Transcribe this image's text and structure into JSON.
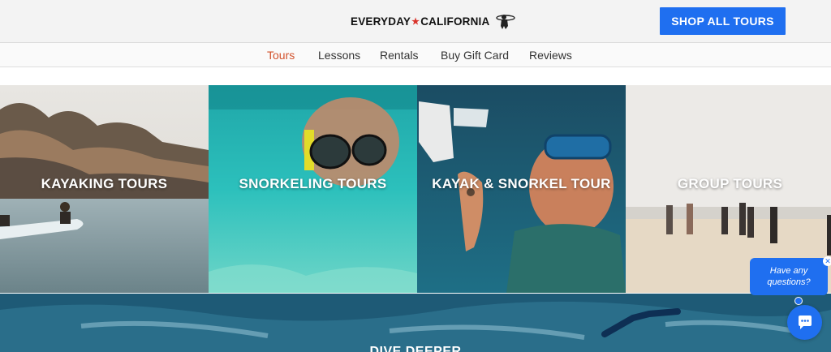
{
  "header": {
    "logo_text_left": "EVERYDAY",
    "logo_text_right": "CALIFORNIA",
    "shop_button_label": "SHOP ALL TOURS"
  },
  "nav": {
    "items": [
      {
        "label": "Tours",
        "active": true
      },
      {
        "label": "Lessons",
        "active": false
      },
      {
        "label": "Rentals",
        "active": false
      },
      {
        "label": "Buy Gift Card",
        "active": false
      },
      {
        "label": "Reviews",
        "active": false
      }
    ]
  },
  "tiles": [
    {
      "label": "KAYAKING TOURS"
    },
    {
      "label": "SNORKELING TOURS"
    },
    {
      "label": "KAYAK & SNORKEL TOUR"
    },
    {
      "label": "GROUP TOURS"
    }
  ],
  "banner": {
    "label": "DIVE DEEPER"
  },
  "chat": {
    "prompt_line1": "Have any",
    "prompt_line2": "questions?",
    "close_icon": "close-icon",
    "launcher_icon": "chat-icon"
  },
  "colors": {
    "accent_blue": "#1f6ff0",
    "active_nav": "#d2522c",
    "logo_star": "#d9322a"
  }
}
